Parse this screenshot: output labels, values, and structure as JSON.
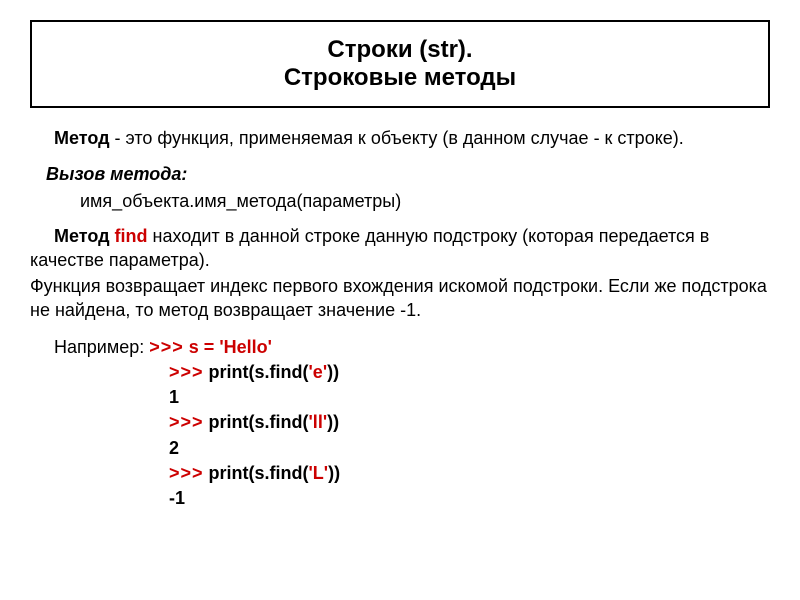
{
  "title": {
    "line1": "Строки (str).",
    "line2": "Строковые методы"
  },
  "para1": {
    "lead": "Метод",
    "rest": " - это функция, применяемая к объекту (в данном случае - к строке)."
  },
  "call": {
    "label": "Вызов метода:",
    "syntax": "имя_объекта.имя_метода(параметры)"
  },
  "para2": {
    "lead": "Метод ",
    "method": "find",
    "rest": " находит в данной строке данную подстроку (которая передается в качестве параметра).",
    "line2": "Функция возвращает индекс первого вхождения искомой подстроки. Если же подстрока не найдена, то метод возвращает значение -1."
  },
  "example": {
    "label": "Например:  ",
    "prompt": ">>>",
    "l1_code": " s = ",
    "l1_str": "'Hello'",
    "l2_code": " print(s.find(",
    "l2_str": "'e'",
    "l2_end": "))",
    "l3_out": "1",
    "l4_code": " print(s.find(",
    "l4_str": "'ll'",
    "l4_end": "))",
    "l5_out": "2",
    "l6_code": " print(s.find(",
    "l6_str": "'L'",
    "l6_end": "))",
    "l7_out": "-1"
  }
}
